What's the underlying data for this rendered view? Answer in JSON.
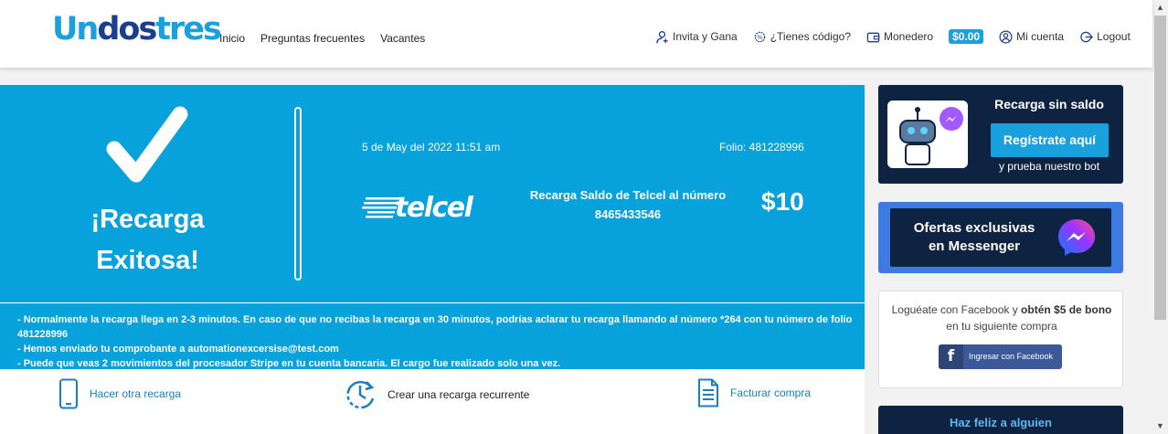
{
  "header": {
    "logo": {
      "part1": "Un",
      "part2": "dos",
      "part3": "tres"
    },
    "nav": [
      {
        "label": "Inicio"
      },
      {
        "label": "Preguntas frecuentes"
      },
      {
        "label": "Vacantes"
      }
    ],
    "invite_label": "Invita y Gana",
    "code_label": "¿Tienes código?",
    "wallet_label": "Monedero",
    "wallet_balance": "$0.00",
    "account_label": "Mi cuenta",
    "logout_label": "Logout"
  },
  "receipt": {
    "title_line1": "¡Recarga",
    "title_line2": "Exitosa!",
    "date": "5 de May del 2022 11:51 am",
    "folio": "Folio: 481228996",
    "carrier": "telcel",
    "description_line1": "Recarga Saldo de Telcel al número",
    "description_line2": "8465433546",
    "amount": "$10",
    "notes": [
      "- Normalmente la recarga llega en 2-3 minutos. En caso de que no recibas la recarga en 30 minutos, podrías aclarar tu recarga llamando al número *264 con tu número de folio 481228996",
      "- Hemos enviado tu comprobante a automationexcersise@test.com",
      "- Puede que veas 2 movimientos del procesador Stripe en tu cuenta bancaria. El cargo fue realizado solo una vez."
    ]
  },
  "actions": {
    "again": "Hacer otra recarga",
    "recurring": "Crear una recarga recurrente",
    "invoice": "Facturar compra"
  },
  "sidebar": {
    "bot_card": {
      "title": "Recarga sin saldo",
      "button": "Regístrate aquí",
      "subtitle": "y prueba nuestro bot"
    },
    "offers_card": {
      "line1": "Ofertas exclusivas",
      "line2": "en Messenger"
    },
    "facebook_card": {
      "text_pre": "Loguéate con Facebook y ",
      "text_bold": "obtén $5 de bono",
      "text_post": " en tu siguiente compra",
      "button": "Ingresar con Facebook"
    },
    "happy_card": {
      "title": "Haz feliz a alguien"
    }
  },
  "colors": {
    "brand_blue": "#07a1dc",
    "navy": "#0e2342",
    "messenger_blue": "#3e7be0"
  }
}
